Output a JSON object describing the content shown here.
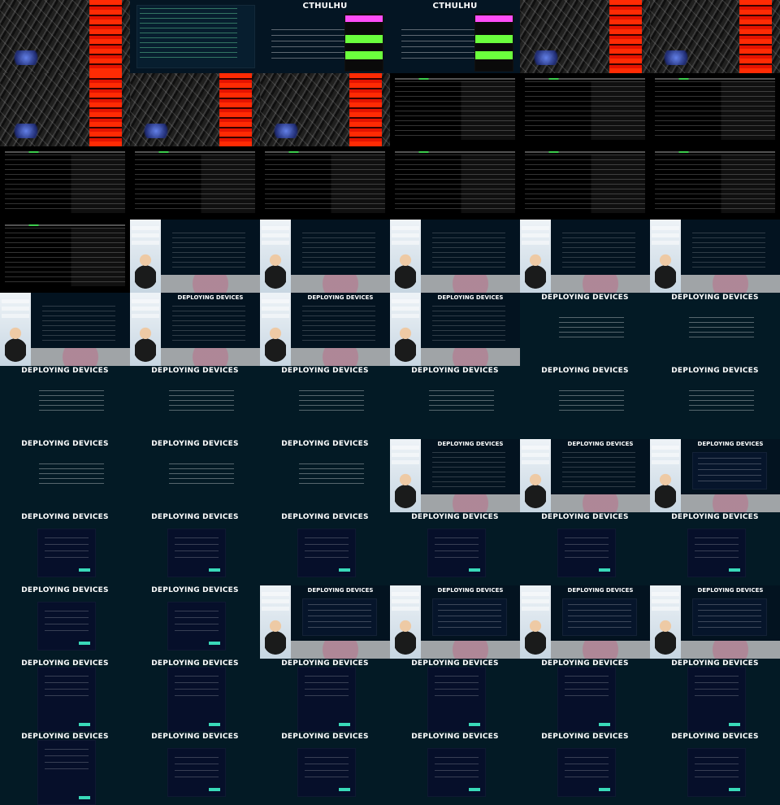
{
  "labels": {
    "cthulhu": "CTHULHU",
    "deploying_devices": "DEPLOYING DEVICES"
  },
  "tiles": [
    "rack",
    "code",
    "cthulhu",
    "cthulhu",
    "rack",
    "rack",
    "rack",
    "rack",
    "rack",
    "term",
    "term",
    "term",
    "term",
    "term",
    "term",
    "term",
    "term",
    "term",
    "term",
    "presenter-term",
    "presenter-term",
    "presenter-term",
    "presenter-term",
    "presenter-term",
    "presenter-term",
    "presenter-deploy",
    "presenter-deploy",
    "presenter-deploy",
    "deploy-list",
    "deploy-list",
    "deploy-list",
    "deploy-list",
    "deploy-list",
    "deploy-list",
    "deploy-list",
    "deploy-list",
    "deploy-list",
    "deploy-list",
    "deploy-list",
    "presenter-deploy",
    "presenter-deploy",
    "presenter-form",
    "deploy-form",
    "deploy-form",
    "deploy-form",
    "deploy-form",
    "deploy-form",
    "deploy-form",
    "deploy-form",
    "deploy-form",
    "presenter-form",
    "presenter-form",
    "presenter-form",
    "presenter-form",
    "deploy-form-tall",
    "deploy-form-tall",
    "deploy-form-tall",
    "deploy-form-tall",
    "deploy-form-tall",
    "deploy-form-tall",
    "deploy-form-tall",
    "deploy-form",
    "deploy-form",
    "deploy-form",
    "deploy-form",
    "deploy-form"
  ]
}
